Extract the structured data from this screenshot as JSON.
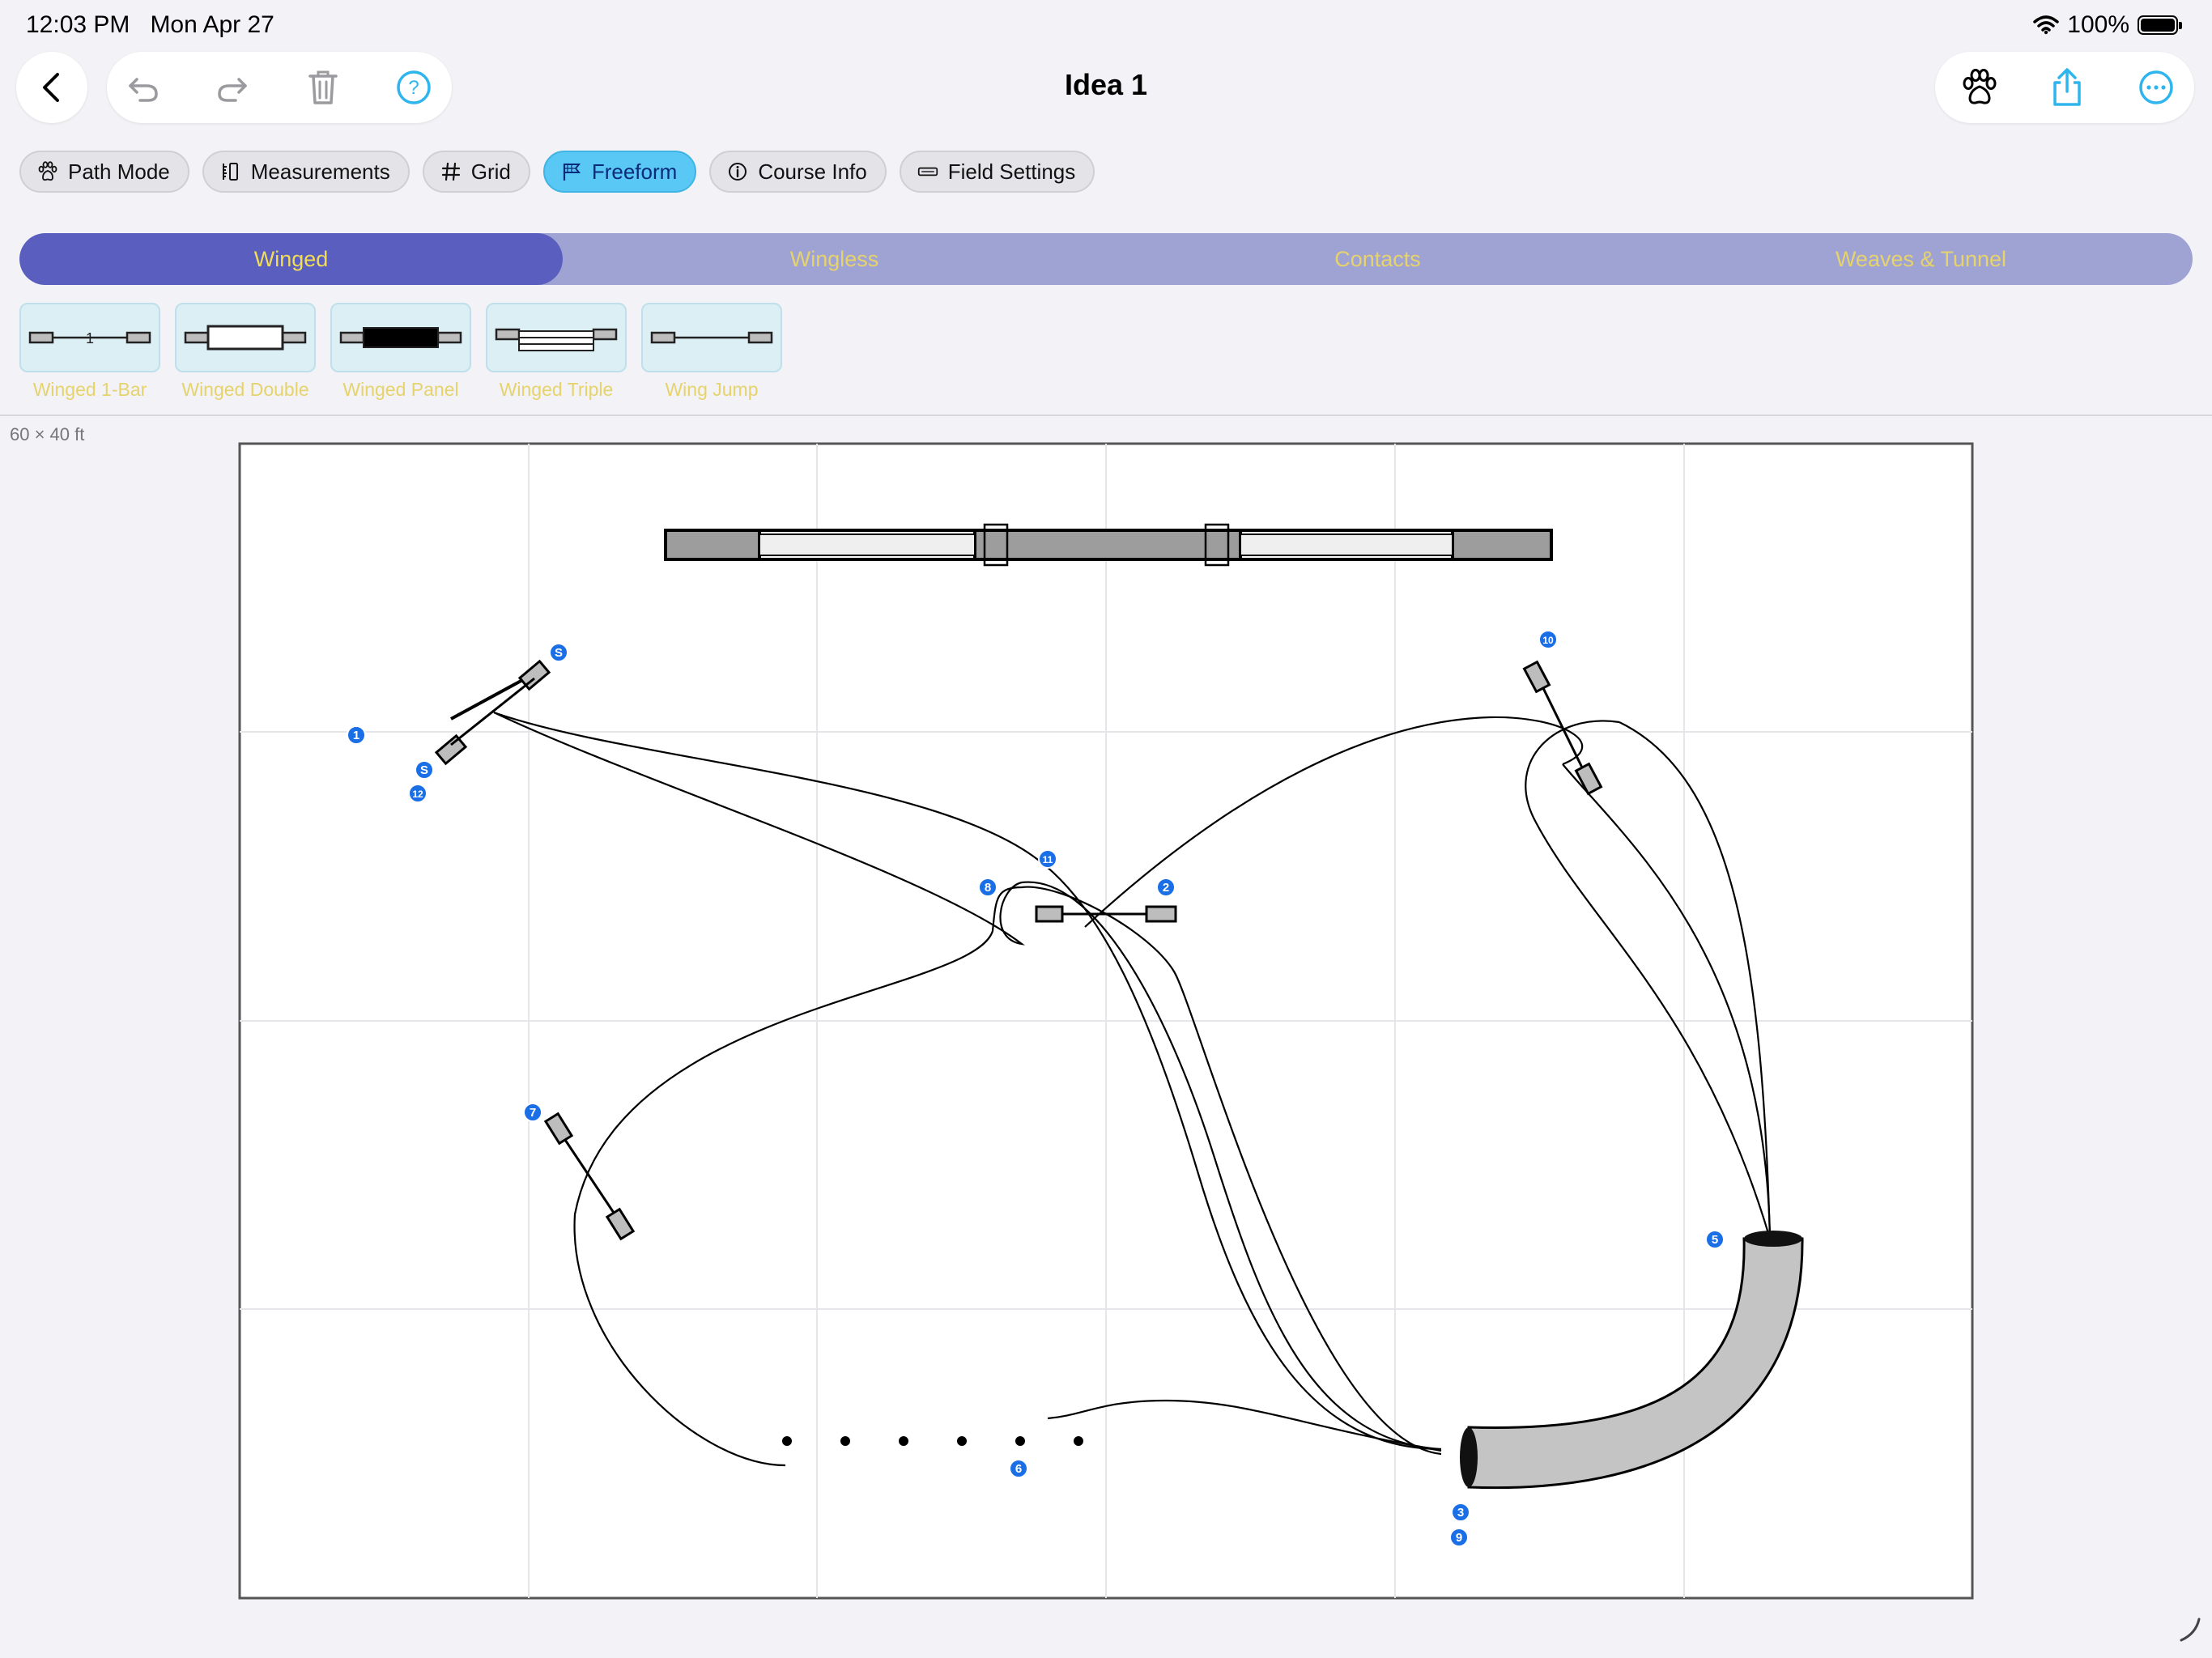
{
  "status_bar": {
    "time": "12:03 PM",
    "date": "Mon Apr 27",
    "battery": "100%"
  },
  "toolbar": {
    "title": "Idea 1",
    "left_icons": [
      "back-icon",
      "undo-icon",
      "redo-icon",
      "trash-icon",
      "help-icon"
    ],
    "right_icons": [
      "paw-icon",
      "share-icon",
      "more-icon"
    ],
    "accent": "#5ac8f5"
  },
  "chips": [
    {
      "label": "Path Mode",
      "icon": "paw-icon",
      "active": false
    },
    {
      "label": "Measurements",
      "icon": "ruler-icon",
      "active": false
    },
    {
      "label": "Grid",
      "icon": "grid-icon",
      "active": false
    },
    {
      "label": "Freeform",
      "icon": "flag-icon",
      "active": true
    },
    {
      "label": "Course Info",
      "icon": "info-icon",
      "active": false
    },
    {
      "label": "Field Settings",
      "icon": "field-icon",
      "active": false
    }
  ],
  "categories": [
    {
      "label": "Winged",
      "active": true
    },
    {
      "label": "Wingless",
      "active": false
    },
    {
      "label": "Contacts",
      "active": false
    },
    {
      "label": "Weaves & Tunnel",
      "active": false
    }
  ],
  "palette": [
    {
      "label": "Winged 1-Bar",
      "icon": "winged-1bar-icon"
    },
    {
      "label": "Winged Double",
      "icon": "winged-double-icon"
    },
    {
      "label": "Winged Panel",
      "icon": "winged-panel-icon"
    },
    {
      "label": "Winged Triple",
      "icon": "winged-triple-icon"
    },
    {
      "label": "Wing Jump",
      "icon": "wing-jump-icon"
    }
  ],
  "field": {
    "dimensions": "60 × 40 ft",
    "markers": [
      "1",
      "2",
      "3",
      "S",
      "S",
      "5",
      "6",
      "7",
      "8",
      "9",
      "10",
      "11",
      "12"
    ],
    "colors": {
      "marker": "#1a6fe6",
      "obstacle": "#bdbdbd",
      "tunnel": "#c4c4c4"
    }
  }
}
